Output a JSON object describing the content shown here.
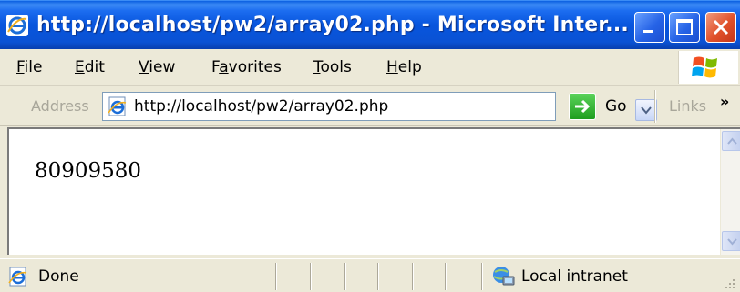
{
  "window": {
    "title": "http://localhost/pw2/array02.php - Microsoft Inter..."
  },
  "menu": {
    "items": [
      {
        "access": "F",
        "rest": "ile"
      },
      {
        "access": "E",
        "rest": "dit"
      },
      {
        "access": "V",
        "rest": "iew"
      },
      {
        "pre": "F",
        "access": "a",
        "rest": "vorites"
      },
      {
        "access": "T",
        "rest": "ools"
      },
      {
        "access": "H",
        "rest": "elp"
      }
    ]
  },
  "address": {
    "label": "Address",
    "url": "http://localhost/pw2/array02.php",
    "go_label": "Go",
    "links_label": "Links",
    "links_chevron": "»"
  },
  "content": {
    "text": "80909580"
  },
  "status": {
    "text": "Done",
    "zone": "Local intranet"
  },
  "icons": {
    "title": "ie-logo-icon",
    "flag": "windows-flag-icon",
    "page": "ie-page-icon",
    "zone": "local-intranet-icon"
  },
  "colors": {
    "titlebar": "#0855dd",
    "chrome": "#ece9d8",
    "close_button": "#e0502a",
    "go_button": "#1f9d1f"
  }
}
